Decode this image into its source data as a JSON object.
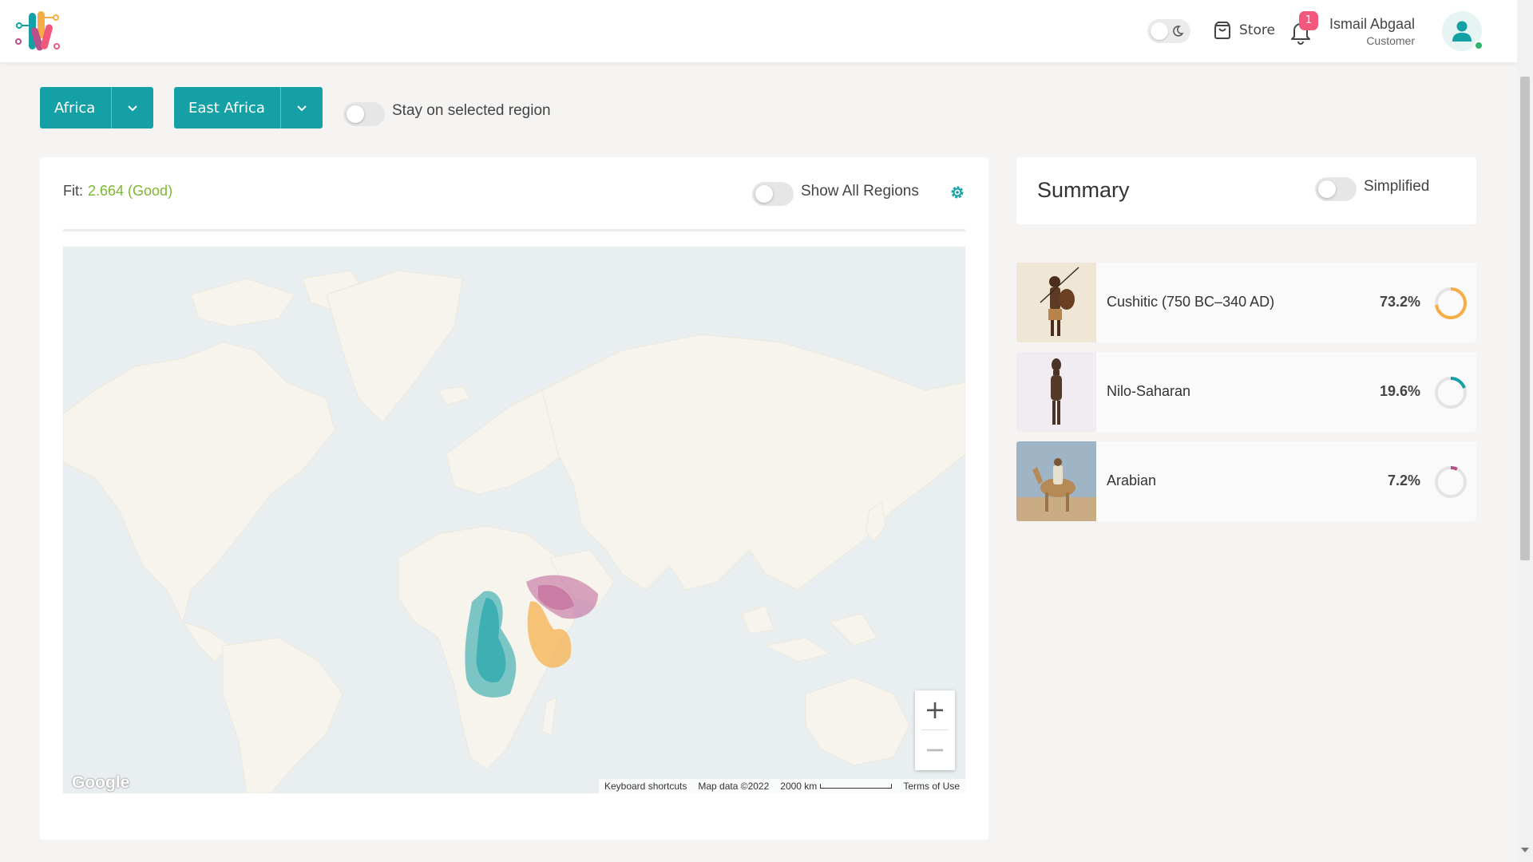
{
  "header": {
    "store_label": "Store",
    "notification_count": "1",
    "user_name": "Ismail Abgaal",
    "user_role": "Customer"
  },
  "filters": {
    "continent": "Africa",
    "region": "East Africa",
    "stay_label": "Stay on selected region"
  },
  "map_panel": {
    "fit_label": "Fit:",
    "fit_value": "2.664 (Good)",
    "show_all_label": "Show All Regions",
    "zoom_in": "+",
    "zoom_out": "−",
    "google_logo": "Google",
    "attribution": {
      "shortcuts": "Keyboard shortcuts",
      "map_data": "Map data ©2022",
      "scale": "2000 km",
      "terms": "Terms of Use"
    }
  },
  "summary": {
    "title": "Summary",
    "simplified_label": "Simplified",
    "populations": [
      {
        "name": "Cushitic (750 BC–340 AD)",
        "percent_label": "73.2%",
        "fraction": 0.732,
        "color": "#f6ad45"
      },
      {
        "name": "Nilo-Saharan",
        "percent_label": "19.6%",
        "fraction": 0.196,
        "color": "#15a0a6"
      },
      {
        "name": "Arabian",
        "percent_label": "7.2%",
        "fraction": 0.072,
        "color": "#b8508a"
      }
    ]
  },
  "colors": {
    "accent": "#15a0a6",
    "fit_good": "#7cb82f",
    "badge": "#f2577c"
  }
}
